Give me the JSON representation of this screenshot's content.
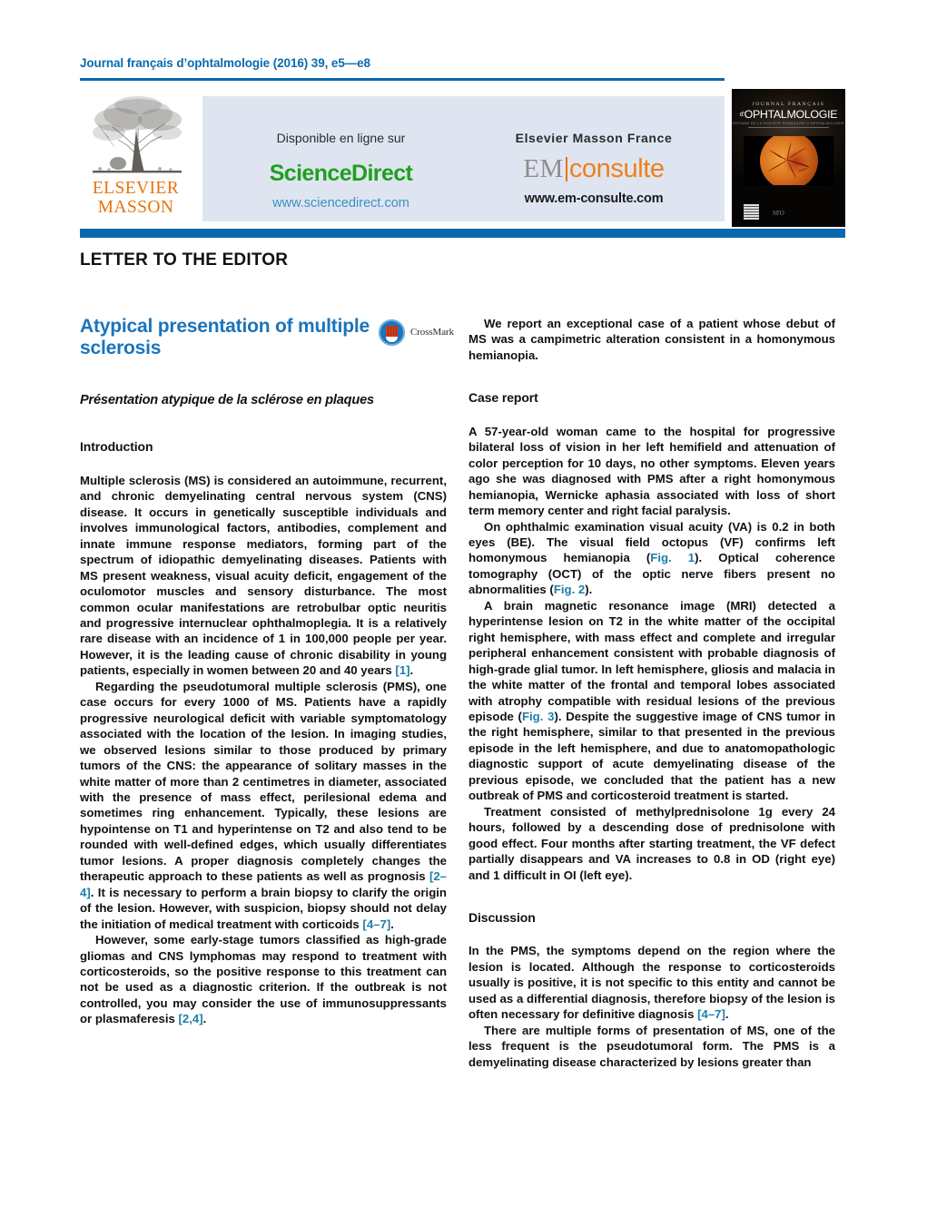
{
  "running_head": "Journal français d’ophtalmologie (2016) 39, e5—e8",
  "masthead": {
    "publisher_logo": {
      "line1": "ELSEVIER",
      "line2": "MASSON"
    },
    "left_panel": {
      "lead": "Disponible en ligne sur",
      "brand": "ScienceDirect",
      "url": "www.sciencedirect.com"
    },
    "right_panel": {
      "lead": "Elsevier Masson France",
      "brand_part1": "EM",
      "brand_part2": "consulte",
      "url": "www.em-consulte.com"
    },
    "cover": {
      "kicker": "JOURNAL FRANÇAIS",
      "title_prefix": "d’",
      "title": "OPHTALMOLOGIE",
      "subtitle": "ORGANE DE LA SOCIÉTÉ FRANÇAISE D’OPHTALMOLOGIE"
    }
  },
  "section_label": "LETTER TO THE EDITOR",
  "article": {
    "title": "Atypical presentation of multiple sclerosis",
    "subtitle": "Présentation atypique de la sclérose en plaques",
    "crossmark_label": "CrossMark"
  },
  "colors": {
    "brand_blue": "#0a68ad",
    "title_blue": "#1a74bb",
    "link_teal": "#1b7faa",
    "elsevier_orange": "#e8740c",
    "sciencedirect_green": "#1ea01e",
    "band_background": "#dfe5f0"
  },
  "left_column": {
    "heading": "Introduction",
    "paragraphs": [
      "Multiple sclerosis (MS) is considered an autoimmune, recurrent, and chronic demyelinating central nervous system (CNS) disease. It occurs in genetically susceptible individuals and involves immunological factors, antibodies, complement and innate immune response mediators, forming part of the spectrum of idiopathic demyelinating diseases. Patients with MS present weakness, visual acuity deficit, engagement of the oculomotor muscles and sensory disturbance. The most common ocular manifestations are retrobulbar optic neuritis and progressive internuclear ophthalmoplegia. It is a relatively rare disease with an incidence of 1 in 100,000 people per year. However, it is the leading cause of chronic disability in young patients, especially in women between 20 and 40 years ",
      "Regarding the pseudotumoral multiple sclerosis (PMS), one case occurs for every 1000 of MS. Patients have a rapidly progressive neurological deficit with variable symptomatology associated with the location of the lesion. In imaging studies, we observed lesions similar to those produced by primary tumors of the CNS: the appearance of solitary masses in the white matter of more than 2 centimetres in diameter, associated with the presence of mass effect, perilesional edema and sometimes ring enhancement. Typically, these lesions are hypointense on T1 and hyperintense on T2 and also tend to be rounded with well-defined edges, which usually differentiates tumor lesions. A proper diagnosis completely changes the therapeutic approach to these patients as well as prognosis ",
      "However, some early-stage tumors classified as high-grade gliomas and CNS lymphomas may respond to treatment with corticosteroids, so the positive response to this treatment can not be used as a diagnostic criterion. If the outbreak is not controlled, you may consider the use of immunosuppressants or plasmaferesis "
    ],
    "p1_ref": "[1]",
    "p1_tail": ".",
    "p2_ref": "[2–4]",
    "p2_tail": ". It is necessary to perform a brain biopsy to clarify the origin of the lesion. However, with suspicion, biopsy should not delay the initiation of medical treatment with corticoids ",
    "p2_ref2": "[4–7]",
    "p2_tail2": ".",
    "p3_ref": "[2,4]",
    "p3_tail": "."
  },
  "right_column": {
    "intro_paragraph": "We report an exceptional case of a patient whose debut of MS was a campimetric alteration consistent in a homonymous hemianopia.",
    "case_heading": "Case report",
    "case_p1": "A 57-year-old woman came to the hospital for progressive bilateral loss of vision in her left hemifield and attenuation of color perception for 10 days, no other symptoms. Eleven years ago she was diagnosed with PMS after a right homonymous hemianopia, Wernicke aphasia associated with loss of short term memory center and right facial paralysis.",
    "case_p2_a": "On ophthalmic examination visual acuity (VA) is 0.2 in both eyes (BE). The visual field octopus (VF) confirms left homonymous hemianopia (",
    "case_p2_fig1": "Fig. 1",
    "case_p2_b": "). Optical coherence tomography (OCT) of the optic nerve fibers present no abnormalities (",
    "case_p2_fig2": "Fig. 2",
    "case_p2_c": ").",
    "case_p3_a": "A brain magnetic resonance image (MRI) detected a hyperintense lesion on T2 in the white matter of the occipital right hemisphere, with mass effect and complete and irregular peripheral enhancement consistent with probable diagnosis of high-grade glial tumor. In left hemisphere, gliosis and malacia in the white matter of the frontal and temporal lobes associated with atrophy compatible with residual lesions of the previous episode (",
    "case_p3_fig3": "Fig. 3",
    "case_p3_b": "). Despite the suggestive image of CNS tumor in the right hemisphere, similar to that presented in the previous episode in the left hemisphere, and due to anatomopathologic diagnostic support of acute demyelinating disease of the previous episode, we concluded that the patient has a new outbreak of PMS and corticosteroid treatment is started.",
    "case_p4": "Treatment consisted of methylprednisolone 1g every 24 hours, followed by a descending dose of prednisolone with good effect. Four months after starting treatment, the VF defect partially disappears and VA increases to 0.8 in OD (right eye) and 1 difficult in OI (left eye).",
    "discussion_heading": "Discussion",
    "disc_p1_a": "In the PMS, the symptoms depend on the region where the lesion is located. Although the response to corticosteroids usually is positive, it is not specific to this entity and cannot be used as a differential diagnosis, therefore biopsy of the lesion is often necessary for definitive diagnosis ",
    "disc_p1_ref": "[4–7]",
    "disc_p1_b": ".",
    "disc_p2": "There are multiple forms of presentation of MS, one of the less frequent is the pseudotumoral form. The PMS is a demyelinating disease characterized by lesions greater than"
  }
}
